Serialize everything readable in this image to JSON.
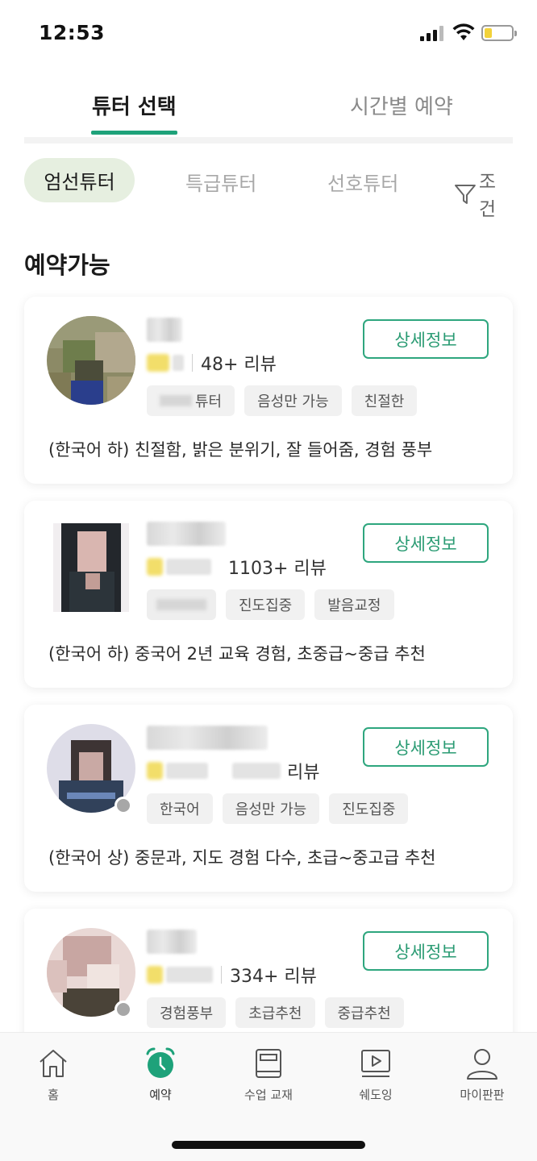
{
  "status_bar": {
    "time": "12:53"
  },
  "top_tabs": {
    "active": "튜터 선택",
    "inactive": "시간별 예약"
  },
  "filters": {
    "active": "엄선튜터",
    "items": [
      "특급튜터",
      "선호튜터"
    ],
    "condition": "조건"
  },
  "section_title": "예약가능",
  "detail_button_label": "상세정보",
  "cards": [
    {
      "reviews": "48+ 리뷰",
      "tags": [
        "튜터",
        "음성만 가능",
        "친절한"
      ],
      "description": "(한국어 하) 친절함, 밝은 분위기, 잘 들어줌, 경험 풍부"
    },
    {
      "reviews": "1103+ 리뷰",
      "tags": [
        "진도집중",
        "발음교정"
      ],
      "description": "(한국어 하) 중국어 2년 교육 경험, 초중급~중급 추천"
    },
    {
      "reviews": "리뷰",
      "tags": [
        "한국어",
        "음성만 가능",
        "진도집중"
      ],
      "description": "(한국어 상) 중문과, 지도 경험 다수, 초급~중고급 추천"
    },
    {
      "reviews": "334+ 리뷰",
      "tags": [
        "경험풍부",
        "초급추천",
        "중급추천"
      ],
      "description": ""
    }
  ],
  "bottom_nav": [
    {
      "label": "홈",
      "icon": "home-icon"
    },
    {
      "label": "예약",
      "icon": "alarm-clock-icon"
    },
    {
      "label": "수업 교재",
      "icon": "book-icon"
    },
    {
      "label": "쉐도잉",
      "icon": "video-play-icon"
    },
    {
      "label": "마이판판",
      "icon": "person-icon"
    }
  ],
  "colors": {
    "accent": "#1ea27a",
    "button_border": "#2ea67e",
    "chip_bg": "#e6efe0"
  }
}
